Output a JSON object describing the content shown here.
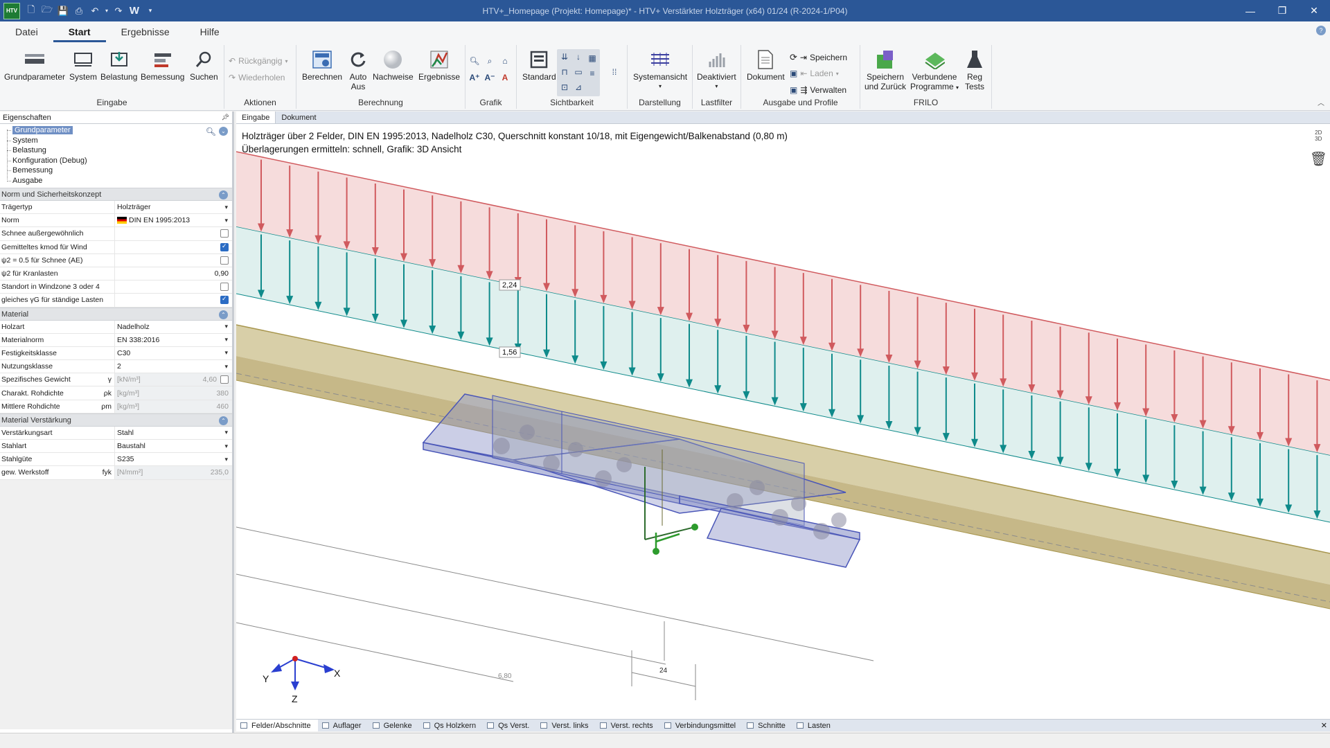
{
  "titlebar": {
    "logo": "HTV",
    "title": "HTV+_Homepage (Projekt: Homepage)* - HTV+ Verstärkter Holzträger (x64) 01/24 (R-2024-1/P04)",
    "minimize": "—",
    "restore": "❐",
    "close": "✕"
  },
  "ribbon_tabs": [
    "Datei",
    "Start",
    "Ergebnisse",
    "Hilfe"
  ],
  "ribbon": {
    "groups": {
      "eingabe": "Eingabe",
      "aktionen": "Aktionen",
      "berechnung": "Berechnung",
      "grafik": "Grafik",
      "sichtbarkeit": "Sichtbarkeit",
      "darstellung": "Darstellung",
      "lastfilter": "Lastfilter",
      "ausgabe": "Ausgabe und Profile",
      "frilo": "FRILO"
    },
    "buttons": {
      "grundparameter": "Grundparameter",
      "system": "System",
      "belastung": "Belastung",
      "bemessung": "Bemessung",
      "suchen": "Suchen",
      "rueckgaengig": "Rückgängig",
      "wiederholen": "Wiederholen",
      "berechnen": "Berechnen",
      "auto_l1": "Auto",
      "auto_l2": "Aus",
      "nachweise": "Nachweise",
      "ergebnisse": "Ergebnisse",
      "standard": "Standard",
      "systemansicht": "Systemansicht",
      "deaktiviert": "Deaktiviert",
      "dokument": "Dokument",
      "speichern": "Speichern",
      "laden": "Laden",
      "verwalten": "Verwalten",
      "speichern_zurueck_l1": "Speichern",
      "speichern_zurueck_l2": "und Zurück",
      "verbundene_l1": "Verbundene",
      "verbundene_l2": "Programme",
      "reg_l1": "Reg",
      "reg_l2": "Tests"
    }
  },
  "left_panel": {
    "title": "Eigenschaften",
    "tree": [
      "Grundparameter",
      "System",
      "Belastung",
      "Konfiguration (Debug)",
      "Bemessung",
      "Ausgabe"
    ],
    "sections": {
      "norm": "Norm und Sicherheitskonzept",
      "material": "Material",
      "verstaerkung": "Material Verstärkung"
    },
    "norm_rows": {
      "traegertyp": {
        "label": "Trägertyp",
        "value": "Holzträger"
      },
      "norm": {
        "label": "Norm",
        "value": "DIN EN 1995:2013"
      },
      "schnee": {
        "label": "Schnee außergewöhnlich",
        "checked": false
      },
      "kmod": {
        "label": "Gemitteltes kmod für Wind",
        "checked": true
      },
      "psi2_schnee": {
        "label": "ψ2 = 0.5 für Schnee (AE)",
        "checked": false
      },
      "psi2_kran": {
        "label": "ψ2 für Kranlasten",
        "value": "0,90"
      },
      "windzone": {
        "label": "Standort in Windzone 3 oder 4",
        "checked": false
      },
      "gamma_g": {
        "label": "gleiches γG für ständige Lasten",
        "checked": true
      }
    },
    "material_rows": {
      "holzart": {
        "label": "Holzart",
        "value": "Nadelholz"
      },
      "materialnorm": {
        "label": "Materialnorm",
        "value": "EN 338:2016"
      },
      "festigkeit": {
        "label": "Festigkeitsklasse",
        "value": "C30"
      },
      "nutzung": {
        "label": "Nutzungsklasse",
        "value": "2"
      },
      "gewicht": {
        "label": "Spezifisches Gewicht",
        "sym": "γ",
        "unit": "[kN/m³]",
        "value": "4,60"
      },
      "rohdichte_k": {
        "label": "Charakt. Rohdichte",
        "sym": "ρk",
        "unit": "[kg/m³]",
        "value": "380"
      },
      "rohdichte_m": {
        "label": "Mittlere Rohdichte",
        "sym": "ρm",
        "unit": "[kg/m³]",
        "value": "460"
      }
    },
    "verst_rows": {
      "art": {
        "label": "Verstärkungsart",
        "value": "Stahl"
      },
      "stahlart": {
        "label": "Stahlart",
        "value": "Baustahl"
      },
      "stahlguete": {
        "label": "Stahlgüte",
        "value": "S235"
      },
      "werkstoff": {
        "label": "gew. Werkstoff",
        "sym": "fyk",
        "unit": "[N/mm²]",
        "value": "235,0"
      }
    }
  },
  "main": {
    "doc_tabs": [
      "Eingabe",
      "Dokument"
    ],
    "description_l1": "Holzträger über 2 Felder, DIN EN 1995:2013, Nadelholz C30, Querschnitt konstant 10/18, mit Eigengewicht/Balkenabstand (0,80 m)",
    "description_l2": "Überlagerungen ermitteln: schnell, Grafik: 3D Ansicht",
    "load_label_top": "2,24",
    "load_label_bottom": "1,56",
    "dim_left": "6,80",
    "dim_center": "24",
    "axis_x": "X",
    "axis_y": "Y",
    "axis_z": "Z",
    "view_toggle": "2D 3D",
    "bottom_tabs": [
      "Felder/Abschnitte",
      "Auflager",
      "Gelenke",
      "Qs Holzkern",
      "Qs Verst.",
      "Verst. links",
      "Verst. rechts",
      "Verbindungsmittel",
      "Schnitte",
      "Lasten"
    ]
  },
  "colors": {
    "titlebar": "#2b5797",
    "load_red": "#d05a5e",
    "load_teal": "#0e8a8a",
    "beam": "#c8b88a",
    "steel": "#6a78c8"
  }
}
